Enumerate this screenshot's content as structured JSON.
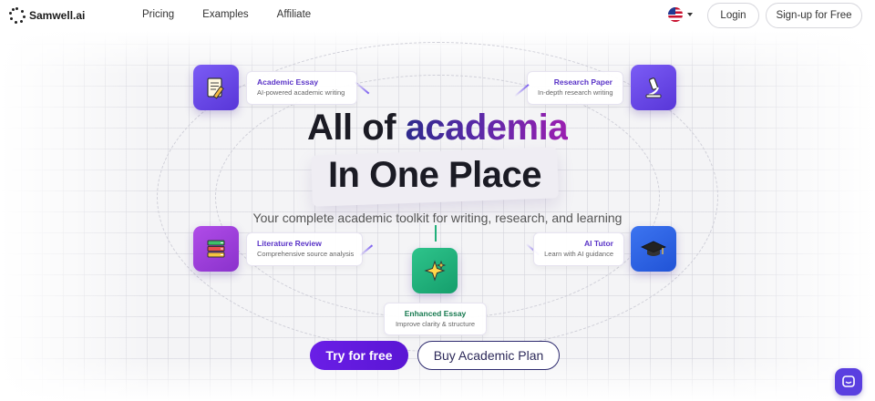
{
  "brand": {
    "name": "Samwell.ai"
  },
  "nav": {
    "items": [
      "Pricing",
      "Examples",
      "Affiliate"
    ]
  },
  "header": {
    "login_label": "Login",
    "signup_label": "Sign-up for Free",
    "language_icon": "us-flag-icon"
  },
  "hero": {
    "title_prefix": "All of ",
    "title_accent": "academia",
    "title_line2": "In One Place",
    "subtitle": "Your complete academic toolkit for writing, research, and learning"
  },
  "tools": {
    "academic_essay": {
      "title": "Academic Essay",
      "desc": "AI-powered academic writing",
      "icon": "notepad-pencil-icon"
    },
    "research_paper": {
      "title": "Research Paper",
      "desc": "In-depth research writing",
      "icon": "microscope-icon"
    },
    "literature_review": {
      "title": "Literature Review",
      "desc": "Comprehensive source analysis",
      "icon": "books-icon"
    },
    "ai_tutor": {
      "title": "AI Tutor",
      "desc": "Learn with AI guidance",
      "icon": "graduation-cap-icon"
    },
    "enhanced_essay": {
      "title": "Enhanced Essay",
      "desc": "Improve clarity & structure",
      "icon": "sparkles-icon"
    }
  },
  "cta": {
    "primary_label": "Try for free",
    "secondary_label": "Buy Academic Plan"
  },
  "colors": {
    "accent": "#6a1ee6",
    "tile_purple": "#6a4be8",
    "tile_violet": "#9f3fdb",
    "tile_blue": "#2d63e3",
    "tile_green": "#1fb37c",
    "chat": "#5a3fe0"
  }
}
